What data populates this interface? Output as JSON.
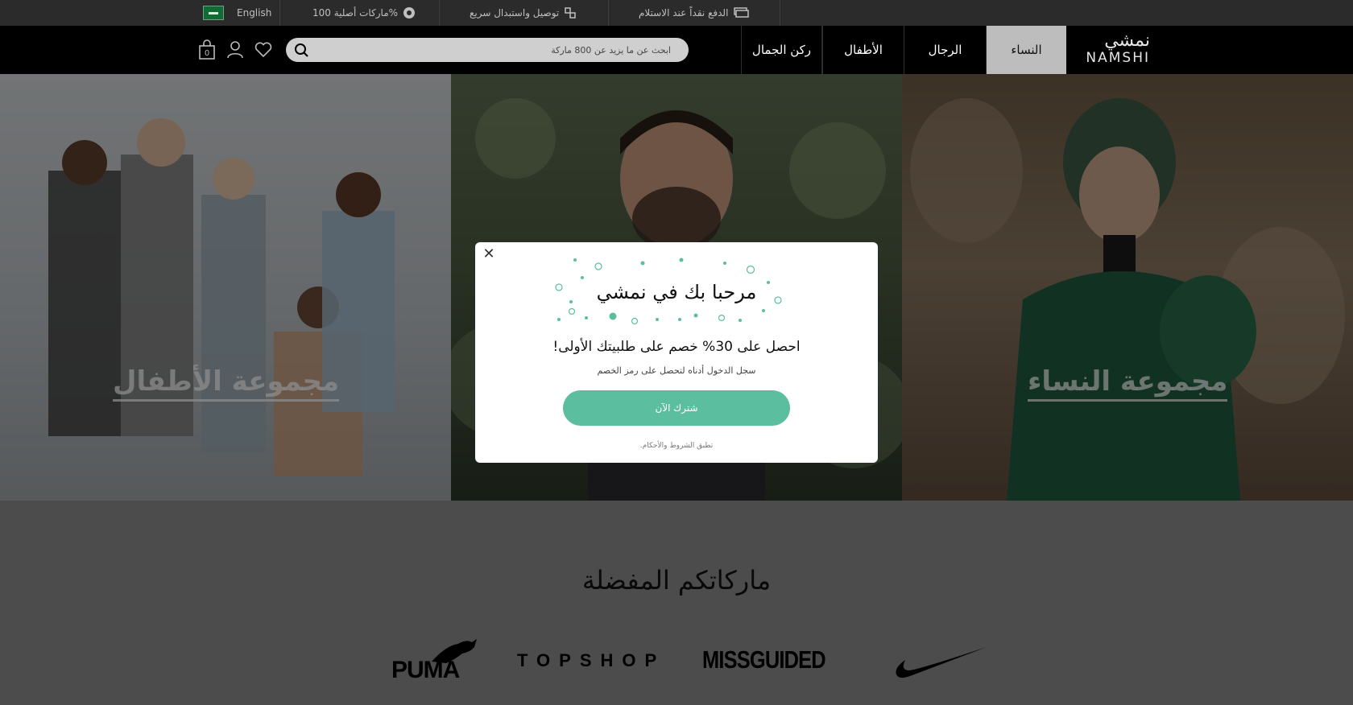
{
  "topbar": {
    "cod": "الدفع نقداً عند الاستلام",
    "delivery": "توصيل واستبدال سريع",
    "authentic": "ماركات أصلية 100%",
    "language": "English",
    "icons": [
      "cash-icon",
      "exchange-icon",
      "badge-icon",
      "saudi-flag-icon"
    ]
  },
  "nav": {
    "logo_ar": "نمشي",
    "logo_en": "NAMSHI",
    "tabs": [
      "النساء",
      "الرجال",
      "الأطفال",
      "ركن الجمال"
    ],
    "active_tab": "النساء",
    "search_placeholder": "ابحث عن ما يزيد عن 800 ماركة",
    "cart_count": "0"
  },
  "hero": {
    "women_title": "مجموعة النساء",
    "kids_title": "مجموعة الأطفال"
  },
  "brands": {
    "title": "ماركاتكم المفضلة",
    "items": [
      "PUMA",
      "TOPSHOP",
      "MISSGUIDED",
      "NIKE"
    ]
  },
  "modal": {
    "title": "مرحبا بك في نمشي",
    "subtitle": "احصل على 30% خصم على طلبيتك الأولى!",
    "note": "سجل الدخول أدناه لتحصل على رمز الخصم",
    "button": "شترك الآن",
    "terms": "تطبق الشروط والأحكام.",
    "accent": "#5bbf9f"
  }
}
